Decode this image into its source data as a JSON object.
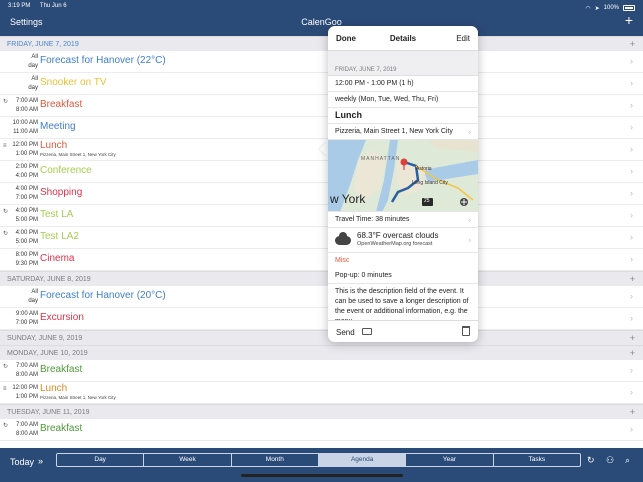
{
  "status": {
    "time": "3:19 PM",
    "date": "Thu Jun 6",
    "battery": "100%"
  },
  "nav": {
    "settings": "Settings",
    "title": "CalenGoo",
    "add": "+"
  },
  "days": [
    {
      "label": "FRIDAY, JUNE 7, 2019",
      "today": true,
      "events": [
        {
          "start": "All",
          "end": "day",
          "title": "Forecast for Hanover (22°C)",
          "color": "#3f7fd0",
          "marker": ""
        },
        {
          "start": "All",
          "end": "day",
          "title": "Snooker on TV",
          "color": "#e8c23a",
          "marker": ""
        },
        {
          "start": "7:00 AM",
          "end": "8:00 AM",
          "title": "Breakfast",
          "color": "#e0583f",
          "marker": "↻"
        },
        {
          "start": "10:00 AM",
          "end": "11:00 AM",
          "title": "Meeting",
          "color": "#3f7fd0",
          "marker": ""
        },
        {
          "start": "12:00 PM",
          "end": "1:00 PM",
          "title": "Lunch",
          "color": "#e0583f",
          "marker": "≡",
          "sub": "Pizzeria, Main Street 1, New York City"
        },
        {
          "start": "2:00 PM",
          "end": "4:00 PM",
          "title": "Conference",
          "color": "#a3cf4e",
          "marker": ""
        },
        {
          "start": "4:00 PM",
          "end": "7:00 PM",
          "title": "Shopping",
          "color": "#d9334b",
          "marker": ""
        },
        {
          "start": "4:00 PM",
          "end": "5:00 PM",
          "title": "Test LA",
          "color": "#a3cf4e",
          "marker": "↻"
        },
        {
          "start": "4:00 PM",
          "end": "5:00 PM",
          "title": "Test LA2",
          "color": "#a3cf4e",
          "marker": "↻"
        },
        {
          "start": "8:00 PM",
          "end": "9:30 PM",
          "title": "Cinema",
          "color": "#d9334b",
          "marker": ""
        }
      ]
    },
    {
      "label": "SATURDAY, JUNE 8, 2019",
      "today": false,
      "events": [
        {
          "start": "All",
          "end": "day",
          "title": "Forecast for Hanover (20°C)",
          "color": "#3f7fd0",
          "marker": ""
        },
        {
          "start": "9:00 AM",
          "end": "7:00 PM",
          "title": "Excursion",
          "color": "#d9334b",
          "marker": ""
        }
      ]
    },
    {
      "label": "SUNDAY, JUNE 9, 2019",
      "today": false,
      "events": []
    },
    {
      "label": "MONDAY, JUNE 10, 2019",
      "today": false,
      "events": [
        {
          "start": "7:00 AM",
          "end": "8:00 AM",
          "title": "Breakfast",
          "color": "#4f9a3a",
          "marker": "↻"
        },
        {
          "start": "12:00 PM",
          "end": "1:00 PM",
          "title": "Lunch",
          "color": "#e08a1f",
          "marker": "≡",
          "sub": "Pizzeria, Main Street 1, New York City"
        }
      ]
    },
    {
      "label": "TUESDAY, JUNE 11, 2019",
      "today": false,
      "events": [
        {
          "start": "7:00 AM",
          "end": "8:00 AM",
          "title": "Breakfast",
          "color": "#4f9a3a",
          "marker": "↻"
        }
      ]
    }
  ],
  "popover": {
    "done": "Done",
    "title": "Details",
    "edit": "Edit",
    "date": "FRIDAY, JUNE 7, 2019",
    "time": "12:00 PM - 1:00 PM (1 h)",
    "recurrence": "weekly (Mon, Tue, Wed, Thu, Fri)",
    "event_title": "Lunch",
    "location": "Pizzeria, Main Street 1, New York City",
    "map": {
      "label_manhattan": "MANHATTAN",
      "label_astoria": "Astoria",
      "label_li": "Long Island City",
      "label_ny": "w York",
      "shield": "25"
    },
    "travel": "Travel Time: 38 minutes",
    "weather_temp": "68.3°F overcast clouds",
    "weather_src": "OpenWeatherMap.org forecast",
    "misc": "Misc",
    "popup": "Pop-up: 0 minutes",
    "description": "This is the description field of the event. It can be used to save a longer description of the event or additional information, e.g. the menu",
    "send": "Send"
  },
  "bottom": {
    "today": "Today",
    "forward": "»",
    "tabs": [
      "Day",
      "Week",
      "Month",
      "Agenda",
      "Year",
      "Tasks"
    ],
    "active_tab": "Agenda"
  }
}
